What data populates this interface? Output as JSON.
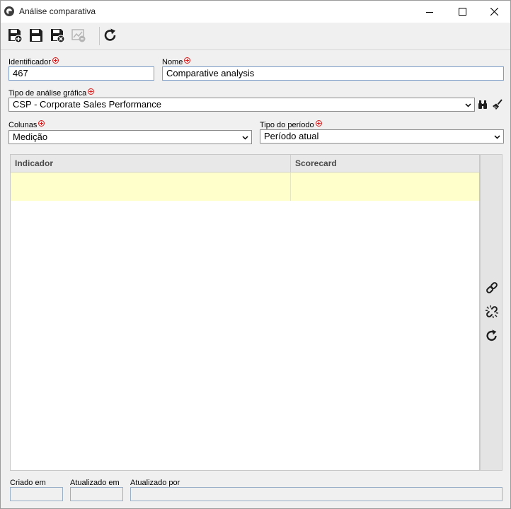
{
  "window": {
    "title": "Análise comparativa"
  },
  "toolbar": {
    "buttons": [
      {
        "name": "save-and-new-button",
        "icon": "save-plus-icon",
        "enabled": true
      },
      {
        "name": "save-button",
        "icon": "save-icon",
        "enabled": true
      },
      {
        "name": "save-and-close-button",
        "icon": "save-close-icon",
        "enabled": true
      },
      {
        "name": "chart-button",
        "icon": "chart-icon",
        "enabled": false
      },
      {
        "name": "refresh-button",
        "icon": "refresh-icon",
        "enabled": true
      }
    ]
  },
  "form": {
    "identificador": {
      "label": "Identificador",
      "value": "467",
      "required": true
    },
    "nome": {
      "label": "Nome",
      "value": "Comparative analysis",
      "required": true
    },
    "tipo_analise": {
      "label": "Tipo de análise gráfica",
      "value": "CSP - Corporate Sales Performance",
      "required": true
    },
    "colunas": {
      "label": "Colunas",
      "value": "Medição",
      "required": true
    },
    "tipo_periodo": {
      "label": "Tipo do período",
      "value": "Período atual",
      "required": true
    }
  },
  "grid": {
    "columns": [
      "Indicador",
      "Scorecard"
    ],
    "rows": [
      [
        "",
        ""
      ]
    ]
  },
  "side_actions": [
    {
      "name": "link-button",
      "icon": "link-icon"
    },
    {
      "name": "unlink-button",
      "icon": "unlink-icon"
    },
    {
      "name": "refresh-grid-button",
      "icon": "refresh-icon"
    }
  ],
  "footer": {
    "criado_em": {
      "label": "Criado em",
      "value": ""
    },
    "atualizado_em": {
      "label": "Atualizado em",
      "value": ""
    },
    "atualizado_por": {
      "label": "Atualizado por",
      "value": ""
    }
  },
  "colors": {
    "accent_border": "#7a9cc6",
    "required": "#d21f1f",
    "highlight_row": "#ffffcc"
  }
}
